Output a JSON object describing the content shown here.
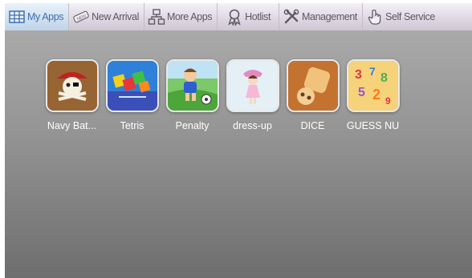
{
  "tabs": [
    {
      "label": "My Apps",
      "icon": "grid-icon",
      "active": true
    },
    {
      "label": "New Arrival",
      "icon": "new-tag-icon",
      "active": false
    },
    {
      "label": "More Apps",
      "icon": "network-icon",
      "active": false
    },
    {
      "label": "Hotlist",
      "icon": "ribbon-icon",
      "active": false
    },
    {
      "label": "Management",
      "icon": "tools-icon",
      "active": false
    },
    {
      "label": "Self Service",
      "icon": "hand-pointer-icon",
      "active": false
    }
  ],
  "apps": [
    {
      "label": "Navy Bat...",
      "icon": "pirate-skull-icon"
    },
    {
      "label": "Tetris",
      "icon": "tetris-blocks-icon"
    },
    {
      "label": "Penalty",
      "icon": "soccer-player-icon"
    },
    {
      "label": "dress-up",
      "icon": "dress-up-girl-icon"
    },
    {
      "label": "DICE",
      "icon": "dice-icon"
    },
    {
      "label": "GUESS NU",
      "icon": "numbers-icon"
    }
  ],
  "colors": {
    "active_tab_text": "#3f6fae",
    "tab_text": "#5a5860",
    "content_bg": "#959595"
  }
}
